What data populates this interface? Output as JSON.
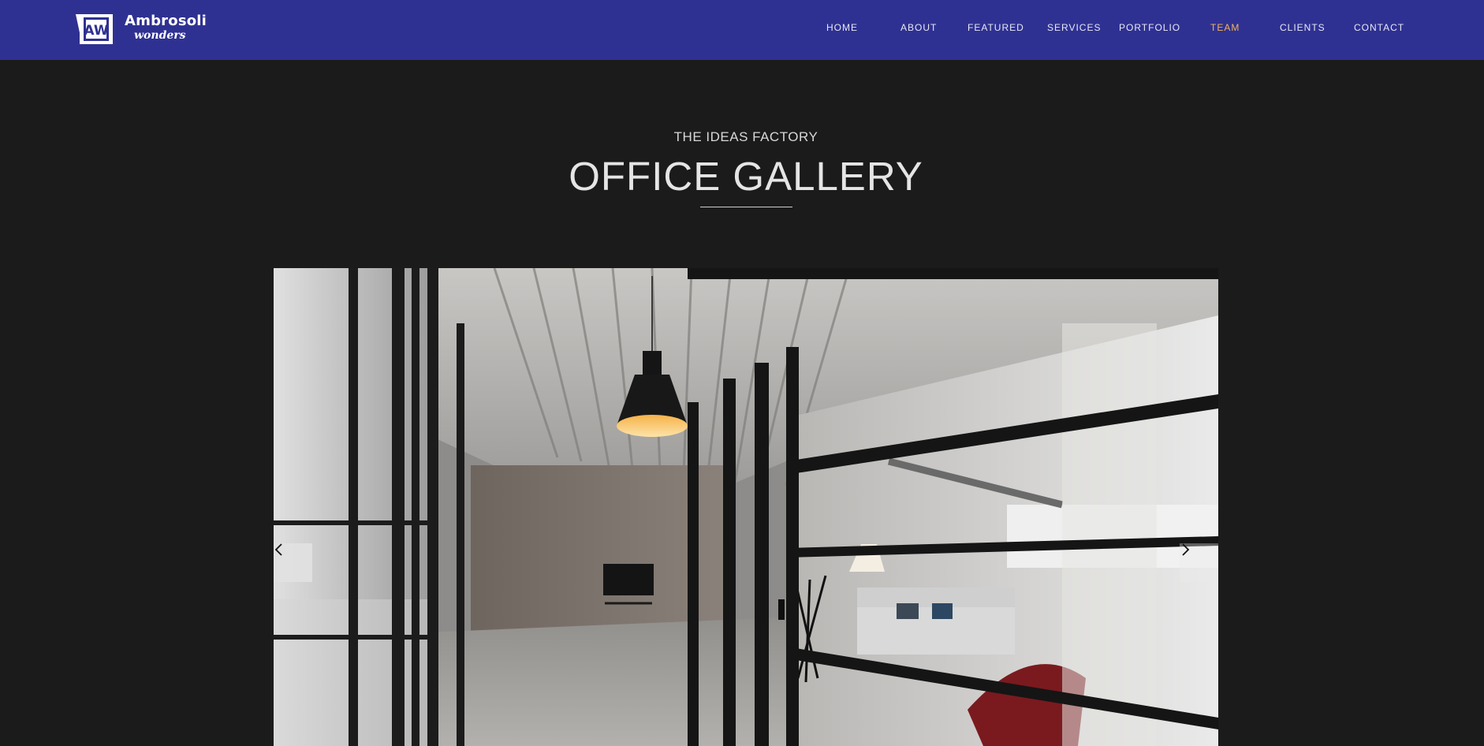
{
  "brand": {
    "name_line1": "Ambrosoli",
    "name_line2": "wonders",
    "monogram": "AW",
    "icon": "brand-logo-icon"
  },
  "nav": {
    "items": [
      {
        "label": "HOME",
        "active": false
      },
      {
        "label": "ABOUT",
        "active": false
      },
      {
        "label": "FEATURED",
        "active": false
      },
      {
        "label": "SERVICES",
        "active": false
      },
      {
        "label": "PORTFOLIO",
        "active": false
      },
      {
        "label": "TEAM",
        "active": true
      },
      {
        "label": "CLIENTS",
        "active": false
      },
      {
        "label": "CONTACT",
        "active": false
      }
    ]
  },
  "section": {
    "subtitle": "THE IDEAS FACTORY",
    "title": "OFFICE GALLERY"
  },
  "gallery": {
    "prev_icon": "chevron-left-icon",
    "next_icon": "chevron-right-icon",
    "image_icon": "office-interior-photo"
  },
  "colors": {
    "nav_bg": "#2f3192",
    "page_bg": "#1b1b1b",
    "active_nav": "#f0b35a"
  }
}
